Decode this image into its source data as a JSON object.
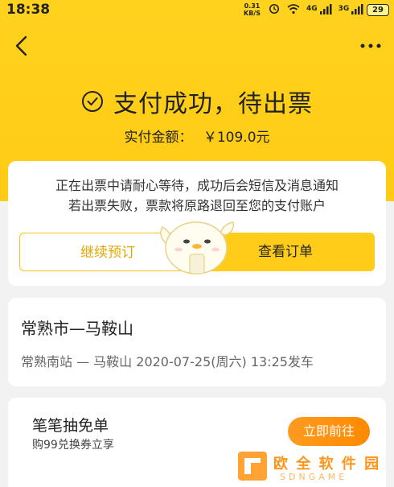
{
  "status_bar": {
    "time": "18:38",
    "net_speed": "0.31",
    "net_unit": "KB/S",
    "signal1": "4G",
    "signal2": "3G",
    "battery": "29"
  },
  "header": {
    "title": "支付成功，待出票",
    "amount_label": "实付金额：",
    "amount_value": "￥109.0元"
  },
  "notice": {
    "line1": "正在出票中请耐心等待，成功后会短信及消息通知",
    "line2": "若出票失败，票款将原路退回至您的支付账户"
  },
  "actions": {
    "continue_label": "继续预订",
    "view_order_label": "查看订单"
  },
  "route": {
    "title": "常熟市—马鞍山",
    "detail": "常熟南站 — 马鞍山  2020-07-25(周六) 13:25发车"
  },
  "promo": {
    "title": "笔笔抽免单",
    "subtitle": "购99兑换券立享",
    "button_label": "立即前往"
  },
  "watermark": {
    "text": "欧 全 软 件 园",
    "sub": "SDNGAME"
  },
  "colors": {
    "brand_yellow": "#ffcd19",
    "accent_orange": "#ff8a00"
  }
}
